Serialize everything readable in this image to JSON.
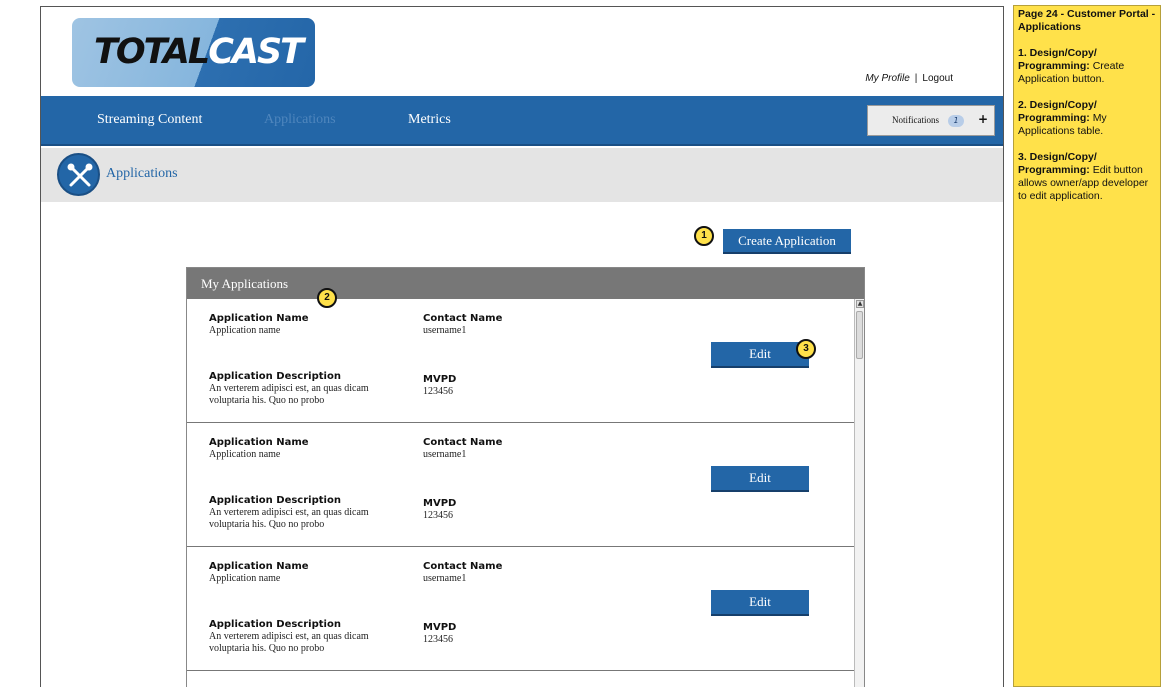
{
  "brand": {
    "word1": "TOTAL",
    "word2": "CAST"
  },
  "user_links": {
    "profile": "My Profile",
    "separator": "|",
    "logout": "Logout"
  },
  "nav": {
    "items": [
      "Streaming Content",
      "Applications",
      "Metrics"
    ],
    "active": "Applications"
  },
  "notifications": {
    "label": "Notifications",
    "count": "1",
    "plus": "+"
  },
  "subheader": {
    "title": "Applications"
  },
  "actions": {
    "create_label": "Create Application"
  },
  "markers": [
    "1",
    "2",
    "3"
  ],
  "applications": {
    "header": "My Applications",
    "fields": {
      "name": "Application Name",
      "contact": "Contact Name",
      "description": "Application Description",
      "mvpd": "MVPD"
    },
    "edit_label": "Edit",
    "rows": [
      {
        "name": "Application name",
        "contact": "username1",
        "description": "An verterem adipisci est, an quas dicam voluptaria his. Quo no probo",
        "mvpd": "123456"
      },
      {
        "name": "Application name",
        "contact": "username1",
        "description": "An verterem adipisci est, an quas dicam voluptaria his. Quo no probo",
        "mvpd": "123456"
      },
      {
        "name": "Application name",
        "contact": "username1",
        "description": "An verterem adipisci est, an quas dicam voluptaria his. Quo no probo",
        "mvpd": "123456"
      }
    ]
  },
  "notes": {
    "title": "Page 24 - Customer Portal - Applications",
    "items": [
      {
        "heading": "1. Design/Copy/ Programming:",
        "text": "Create Application button."
      },
      {
        "heading": "2. Design/Copy/ Programming:",
        "text": "My Applications table."
      },
      {
        "heading": "3. Design/Copy/ Programming:",
        "text": "Edit button allows owner/app developer to edit application."
      }
    ]
  },
  "colors": {
    "nav_blue": "#2366a7",
    "note_yellow": "#ffe14a",
    "table_header": "#777777"
  }
}
